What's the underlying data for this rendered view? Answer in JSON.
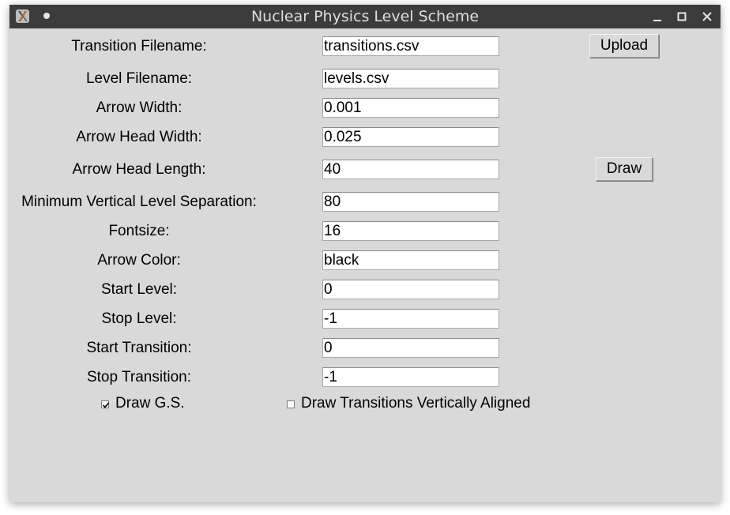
{
  "window": {
    "title": "Nuclear Physics Level Scheme"
  },
  "form": {
    "fields": [
      {
        "label": "Transition Filename:",
        "value": "transitions.csv"
      },
      {
        "label": "Level Filename:",
        "value": "levels.csv"
      },
      {
        "label": "Arrow Width:",
        "value": "0.001"
      },
      {
        "label": "Arrow Head Width:",
        "value": "0.025"
      },
      {
        "label": "Arrow Head Length:",
        "value": "40"
      },
      {
        "label": "Minimum Vertical Level Separation:",
        "value": "80"
      },
      {
        "label": "Fontsize:",
        "value": "16"
      },
      {
        "label": "Arrow Color:",
        "value": "black"
      },
      {
        "label": "Start Level:",
        "value": "0"
      },
      {
        "label": "Stop Level:",
        "value": "-1"
      },
      {
        "label": "Start Transition:",
        "value": "0"
      },
      {
        "label": "Stop Transition:",
        "value": "-1"
      }
    ],
    "buttons": {
      "upload_label": "Upload",
      "draw_label": "Draw"
    },
    "checkboxes": {
      "draw_gs": {
        "label": "Draw G.S.",
        "checked": true
      },
      "vertical_aligned": {
        "label": "Draw Transitions Vertically Aligned",
        "checked": false
      }
    }
  }
}
